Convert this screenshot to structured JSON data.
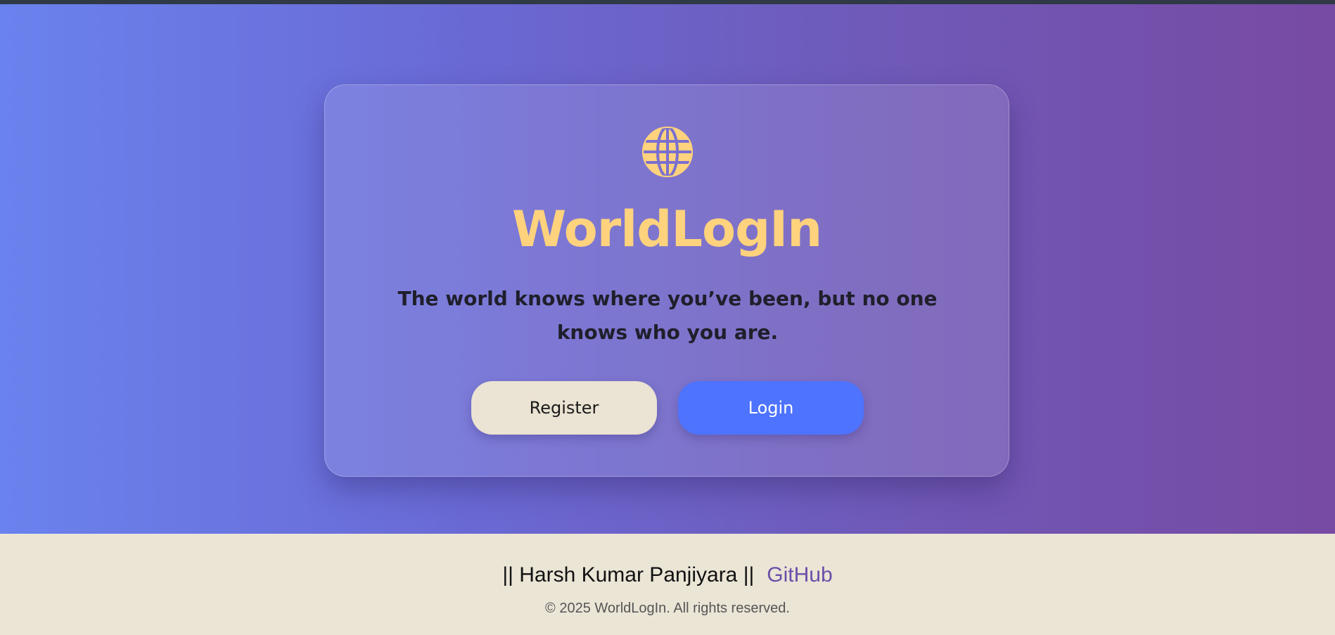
{
  "app": {
    "title": "WorldLogIn",
    "tagline": "The world knows where you’ve been, but no one knows who you are.",
    "icon": "globe-icon"
  },
  "actions": {
    "register_label": "Register",
    "login_label": "Login"
  },
  "footer": {
    "author": "|| Harsh Kumar Panjiyara ||",
    "github_label": "GitHub",
    "copyright": "© 2025 WorldLogIn. All rights reserved."
  },
  "colors": {
    "accent": "#ffd27d",
    "login_button": "#4d73ff",
    "register_button": "#ebe3d3",
    "footer_bg": "#ebe5d6",
    "github_link": "#6a4ea8"
  }
}
